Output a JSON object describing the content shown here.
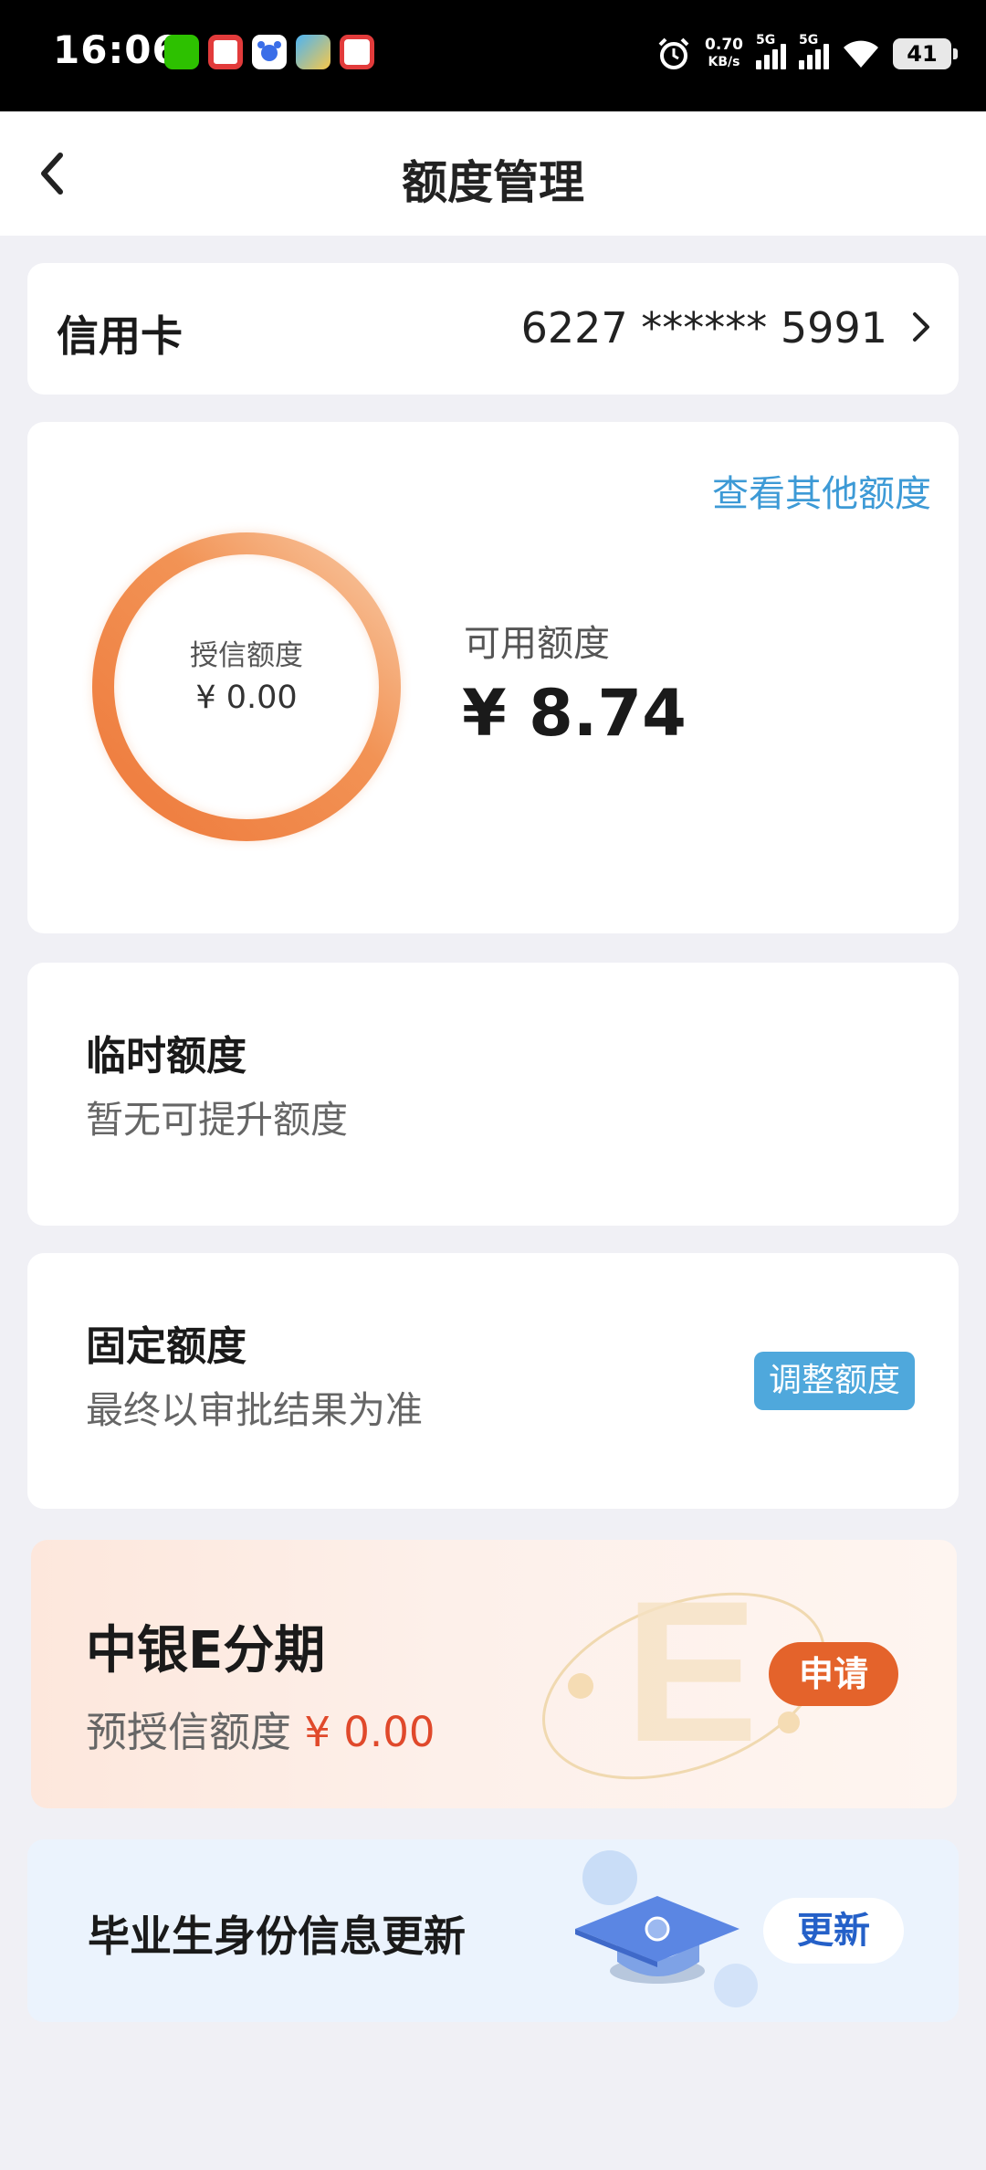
{
  "status_bar": {
    "time": "16:06",
    "network_speed": "0.70",
    "network_unit": "KB/s",
    "signal_1": "5G",
    "signal_2": "5G",
    "battery": "41",
    "apps": [
      "wechat-icon",
      "shop-app-icon",
      "baidu-icon",
      "map-app-icon",
      "video-app-icon"
    ]
  },
  "nav": {
    "title": "额度管理",
    "back_icon": "chevron-left-icon"
  },
  "account": {
    "type": "信用卡",
    "number": "6227 ****** 5991"
  },
  "limit": {
    "other_link": "查看其他额度",
    "credit_label": "授信额度",
    "credit_value": "¥ 0.00",
    "available_label": "可用额度",
    "available_value": "¥ 8.74"
  },
  "temporary": {
    "title": "临时额度",
    "subtitle": "暂无可提升额度"
  },
  "fixed": {
    "title": "固定额度",
    "subtitle": "最终以审批结果为准",
    "button": "调整额度"
  },
  "installment": {
    "title": "中银E分期",
    "pre_label": "预授信额度",
    "pre_value": "¥ 0.00",
    "button": "申请"
  },
  "graduate": {
    "title": "毕业生身份信息更新",
    "button": "更新"
  },
  "colors": {
    "accent_orange": "#e4632b",
    "link_blue": "#3d9ad6",
    "button_blue": "#4fa8dc",
    "amount_red": "#e0492b"
  }
}
